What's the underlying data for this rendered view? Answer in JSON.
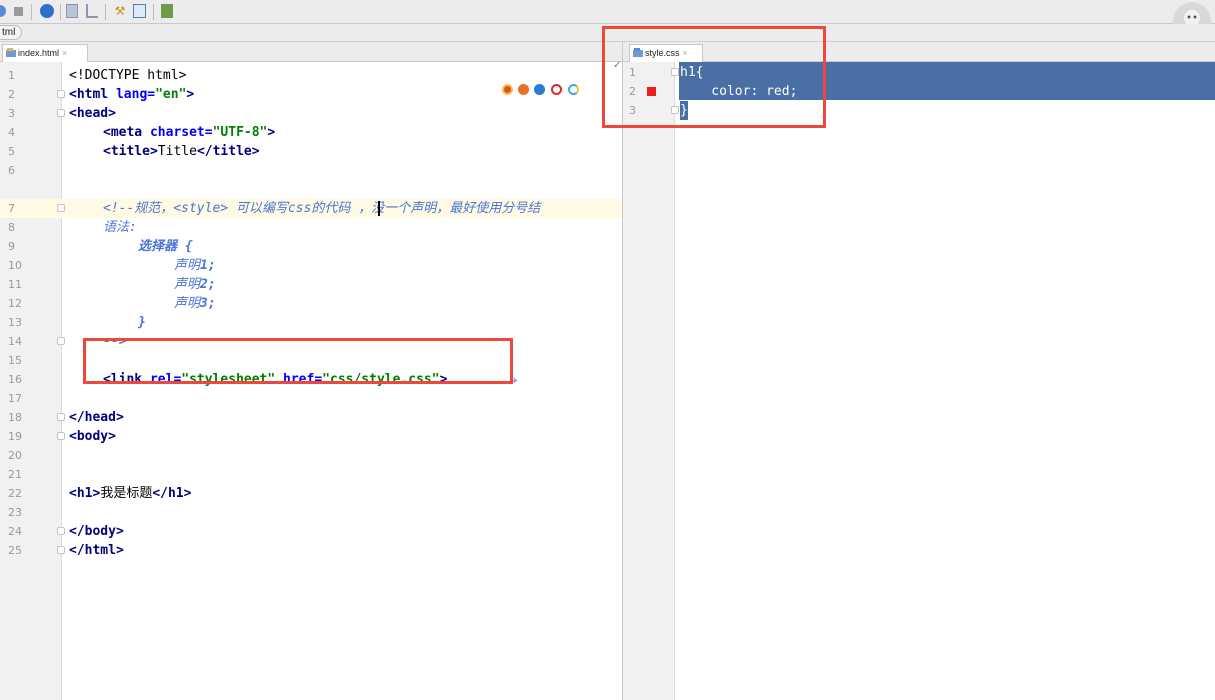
{
  "breadcrumb": "tml",
  "left_tab": {
    "label": "index.html",
    "close": "×"
  },
  "right_tab": {
    "label": "style.css",
    "close": "×"
  },
  "left_editor": {
    "line_numbers": [
      "1",
      "2",
      "3",
      "4",
      "5",
      "6",
      "7",
      "8",
      "9",
      "10",
      "11",
      "12",
      "13",
      "14",
      "15",
      "16",
      "17",
      "18",
      "19",
      "20",
      "21",
      "22",
      "23",
      "24",
      "25"
    ],
    "l1": "<!DOCTYPE html>",
    "l2_tag": "<html ",
    "l2_attr": "lang=",
    "l2_val": "\"en\"",
    "l2_end": ">",
    "l3": "<head>",
    "l4_tag": "<meta ",
    "l4_attr": "charset=",
    "l4_val": "\"UTF-8\"",
    "l4_end": ">",
    "l5_open": "<title>",
    "l5_text": "Title",
    "l5_close": "</title>",
    "l7": "<!--规范，<style> 可以编写css的代码 ，没一个声明，最好使用分号结",
    "l8": "语法:",
    "l9": "选择器 {",
    "l10_a": "声明",
    "l10_b": "1;",
    "l11_a": "声明",
    "l11_b": "2;",
    "l12_a": "声明",
    "l12_b": "3;",
    "l13": "}",
    "l14": "-->",
    "l16_tag": "<link ",
    "l16_attr1": "rel=",
    "l16_val1": "\"stylesheet\"",
    "l16_attr2": " href=",
    "l16_val2": "\"css/style.css\"",
    "l16_end": ">",
    "l18": "</head>",
    "l19": "<body>",
    "l22_open": "<h1>",
    "l22_text": "我是标题",
    "l22_close": "</h1>",
    "l24": "</body>",
    "l25": "</html>"
  },
  "right_editor": {
    "line_numbers": [
      "1",
      "2",
      "3"
    ],
    "l1": "h1{",
    "l2": "    color: red;",
    "l3": "}"
  },
  "colors": {
    "highlight_box": "#f0473c",
    "selection": "#4a6fa5",
    "breakpoint": "#e8231f"
  },
  "browser_icons": [
    "chrome-icon",
    "firefox-icon",
    "safari-icon",
    "opera-icon",
    "ie-icon"
  ]
}
